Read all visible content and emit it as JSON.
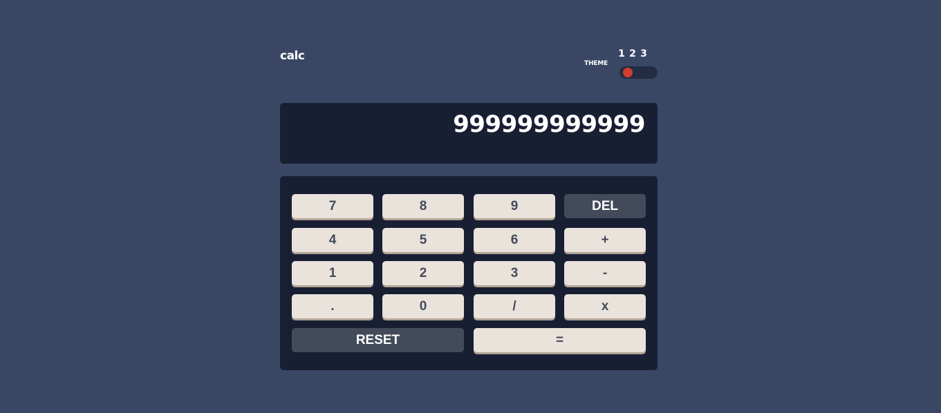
{
  "header": {
    "logo": "calc",
    "theme_label": "THEME",
    "theme_options": [
      "1",
      "2",
      "3"
    ],
    "active_theme": 1
  },
  "screen": {
    "value": "999999999999"
  },
  "keypad": {
    "row1": [
      "7",
      "8",
      "9",
      "DEL"
    ],
    "row2": [
      "4",
      "5",
      "6",
      "+"
    ],
    "row3": [
      "1",
      "2",
      "3",
      "-"
    ],
    "row4": [
      ".",
      "0",
      "/",
      "x"
    ],
    "reset": "RESET",
    "equals": "="
  },
  "colors": {
    "background": "#3a4764",
    "screen": "#181f33",
    "keypad": "#181f33",
    "key": "#eae3dc",
    "key_shadow": "#b4a597",
    "key_text": "#434a59",
    "dark_key": "#434a59",
    "toggle_knob": "#d03f2f"
  }
}
